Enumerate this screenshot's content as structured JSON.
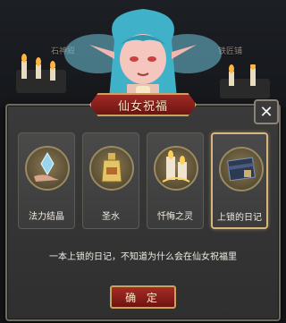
{
  "hud": {
    "left_label": "石神殿",
    "right_label": "铁匠铺"
  },
  "dialog": {
    "title": "仙女祝福",
    "close_glyph": "✕",
    "description": "一本上锁的日记，不知道为什么会在仙女祝福里",
    "confirm_label": "确 定"
  },
  "items": [
    {
      "label": "法力结晶",
      "icon": "crystal-icon",
      "selected": false
    },
    {
      "label": "圣水",
      "icon": "holy-water-icon",
      "selected": false
    },
    {
      "label": "忏悔之灵",
      "icon": "repentance-spirit-icon",
      "selected": false
    },
    {
      "label": "上锁的日记",
      "icon": "locked-diary-icon",
      "selected": true
    }
  ],
  "colors": {
    "panel_bg": "#353535",
    "banner_red": "#8a1f1a",
    "selection_gold": "#d9b77a",
    "fairy_hair": "#3fb1c9"
  }
}
